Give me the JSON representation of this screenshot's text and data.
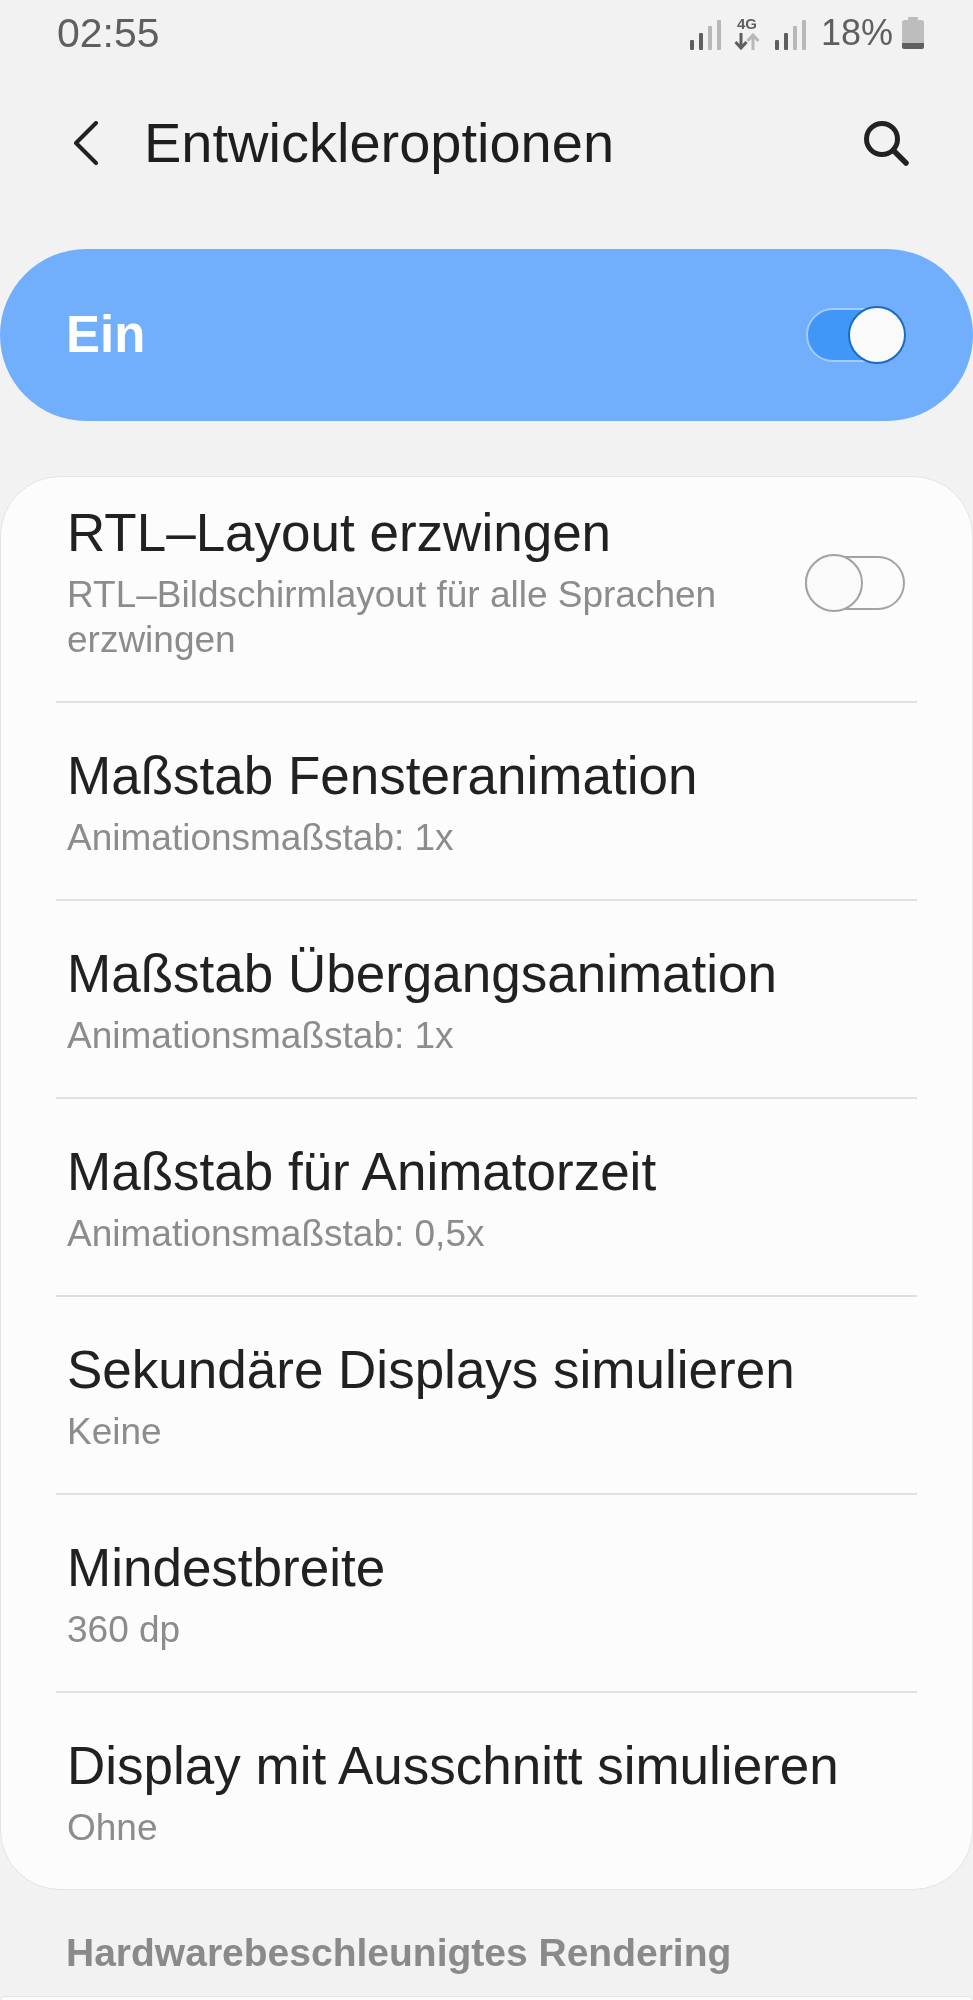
{
  "status_bar": {
    "time": "02:55",
    "network_type": "4G",
    "battery": "18%"
  },
  "header": {
    "title": "Entwickleroptionen"
  },
  "master_switch": {
    "label": "Ein",
    "on": true
  },
  "settings": [
    {
      "kind": "switch",
      "title": "RTL–Layout erzwingen",
      "summary": "RTL–Bildschirmlayout für alle Sprachen erzwingen",
      "on": false
    },
    {
      "kind": "value",
      "title": "Maßstab Fensteranimation",
      "summary": "Animationsmaßstab: 1x"
    },
    {
      "kind": "value",
      "title": "Maßstab Übergangsanimation",
      "summary": "Animationsmaßstab: 1x"
    },
    {
      "kind": "value",
      "title": "Maßstab für Animatorzeit",
      "summary": "Animationsmaßstab: 0,5x"
    },
    {
      "kind": "value",
      "title": "Sekundäre Displays simulieren",
      "summary": "Keine"
    },
    {
      "kind": "value",
      "title": "Mindestbreite",
      "summary": "360 dp"
    },
    {
      "kind": "value",
      "title": "Display mit Ausschnitt simulieren",
      "summary": "Ohne"
    }
  ],
  "section_header": "Hardwarebeschleunigtes Rendering"
}
